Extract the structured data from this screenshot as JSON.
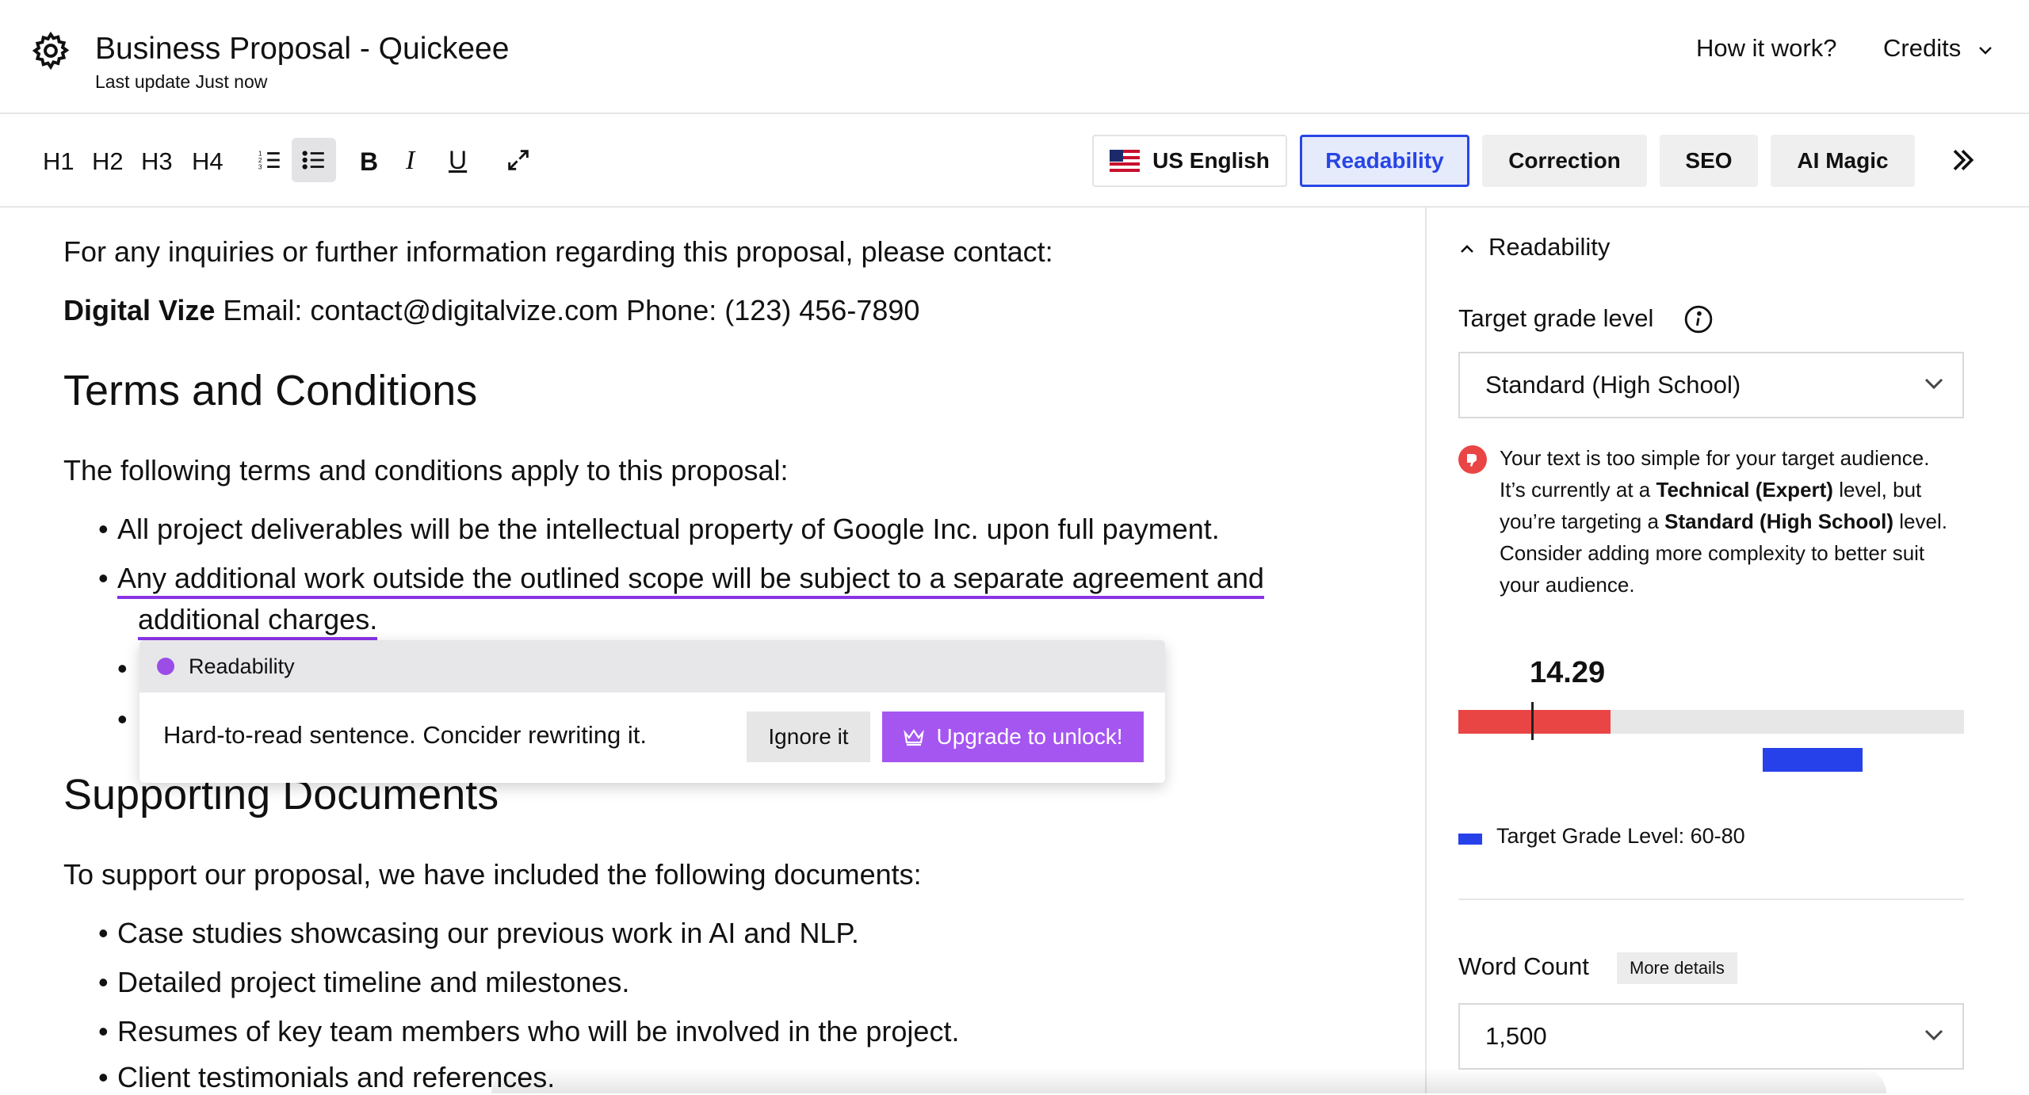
{
  "header": {
    "title": "Business Proposal - Quickeee",
    "last_update": "Last update Just now",
    "how_it_works": "How it work?",
    "credits": "Credits"
  },
  "toolbar": {
    "headings": [
      "H1",
      "H2",
      "H3",
      "H4"
    ],
    "bold": "B",
    "italic": "I",
    "underline": "U",
    "language": "US English",
    "tabs": {
      "readability": "Readability",
      "correction": "Correction",
      "seo": "SEO",
      "ai_magic": "AI Magic"
    },
    "active_tab": "Readability"
  },
  "editor": {
    "contact_intro": "For any inquiries or further information regarding this proposal, please contact:",
    "contact_company": "Digital Vize",
    "contact_details": " Email: contact@digitalvize.com Phone: (123) 456-7890",
    "terms_heading": "Terms and Conditions",
    "terms_intro": "The following terms and conditions apply to this proposal:",
    "terms_items": [
      "All project deliverables will be the intellectual property of Google Inc. upon full payment.",
      "Any additional work outside the outlined scope will be subject to a separate agreement and",
      "additional charges."
    ],
    "support_heading": "Supporting Documents",
    "support_intro": "To support our proposal, we have included the following documents:",
    "support_items": [
      "Case studies showcasing our previous work in AI and NLP.",
      "Detailed project timeline and milestones.",
      "Resumes of key team members who will be involved in the project.",
      "Client testimonials and references."
    ]
  },
  "popover": {
    "category": "Readability",
    "message": "Hard-to-read sentence. Concider rewriting it.",
    "ignore_label": "Ignore it",
    "upgrade_label": "Upgrade to unlock!"
  },
  "panel": {
    "section_title": "Readability",
    "target_grade_label": "Target grade level",
    "target_grade_value": "Standard (High School)",
    "warning_parts": {
      "a": "Your text is too simple for your target audience. It’s currently at a ",
      "b": "Technical (Expert)",
      "c": " level, but you’re targeting a ",
      "d": "Standard (High School)",
      "e": " level. Consider adding more complexity to better suit your audience."
    },
    "score": "14.29",
    "legend": "Target Grade Level: 60-80",
    "word_count_label": "Word Count",
    "more_details": "More details",
    "word_count_value": "1,500"
  },
  "colors": {
    "accent_blue": "#2845e6",
    "warning_red": "#ea4545",
    "upgrade_purple": "#a656f0",
    "underline_purple": "#8a33e6"
  },
  "icons": [
    "gear-icon",
    "chevron-down-icon",
    "numbered-list-icon",
    "bulleted-list-icon",
    "expand-icon",
    "us-flag-icon",
    "double-chevron-right-icon",
    "chevron-up-icon",
    "info-icon",
    "thumbs-down-icon",
    "crown-icon"
  ]
}
